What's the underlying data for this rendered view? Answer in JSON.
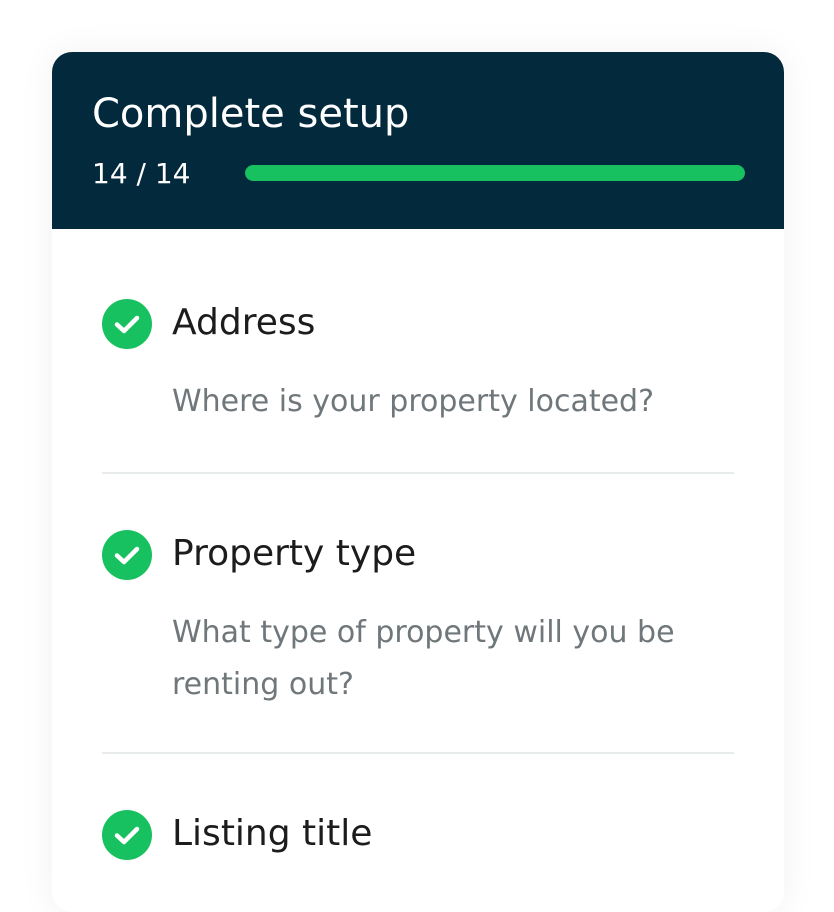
{
  "header": {
    "title": "Complete setup",
    "progress_text": "14 / 14",
    "progress_fraction": 1.0
  },
  "colors": {
    "header_bg": "#03293d",
    "accent_green": "#17c15f",
    "title_text": "#1c1c1c",
    "muted_text": "#6f777b"
  },
  "steps": [
    {
      "title": "Address",
      "description": "Where is your property located?",
      "status": "complete",
      "icon": "check-circle-icon"
    },
    {
      "title": "Property type",
      "description": "What type of property will you be renting out?",
      "status": "complete",
      "icon": "check-circle-icon"
    },
    {
      "title": "Listing title",
      "status": "complete",
      "icon": "check-circle-icon"
    }
  ]
}
